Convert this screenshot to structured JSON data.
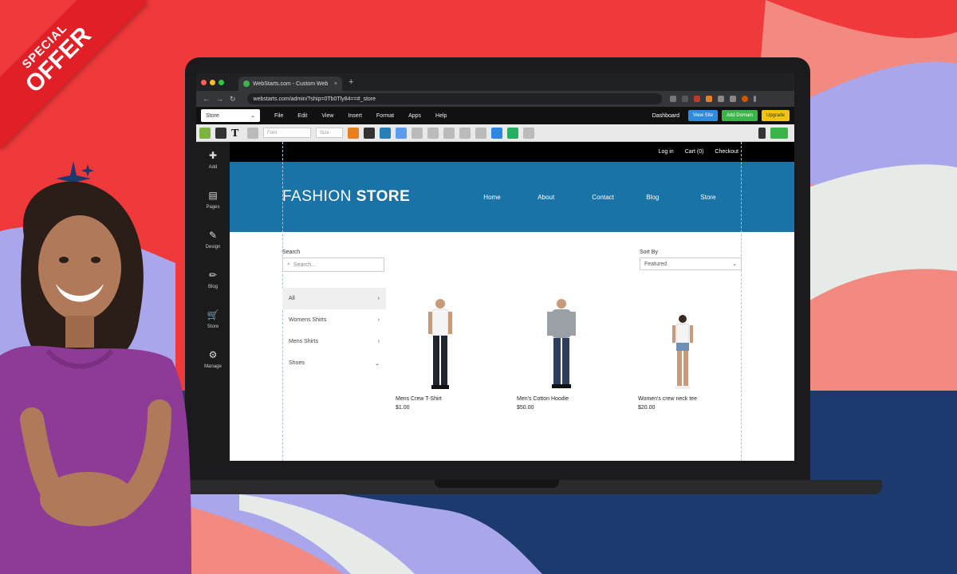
{
  "promo": {
    "line1": "SPECIAL",
    "line2": "OFFER"
  },
  "browser": {
    "tab_title": "WebStarts.com - Custom Web",
    "tab_close": "×",
    "new_tab": "+",
    "url": "webstarts.com/admin/?ship=0Tb0Tly84==#_store"
  },
  "editor": {
    "page_select": "Store",
    "menu": [
      "File",
      "Edit",
      "View",
      "Insert",
      "Format",
      "Apps",
      "Help"
    ],
    "dashboard": "Dashboard",
    "view_site": "View Site",
    "add_domain": "Add Domain",
    "upgrade": "Upgrade",
    "font_select": "Font",
    "size_select": "Size",
    "sidebar": [
      {
        "label": "Add",
        "icon": "plus-icon"
      },
      {
        "label": "Pages",
        "icon": "page-icon"
      },
      {
        "label": "Design",
        "icon": "brush-icon"
      },
      {
        "label": "Blog",
        "icon": "pencil-icon"
      },
      {
        "label": "Store",
        "icon": "cart-icon"
      },
      {
        "label": "Manage",
        "icon": "gear-icon"
      }
    ]
  },
  "site": {
    "top_links": [
      "Log in",
      "Cart (0)",
      "Checkout"
    ],
    "logo_light": "FASHION ",
    "logo_bold": "STORE",
    "nav": [
      "Home",
      "About",
      "Contact",
      "Blog",
      "Store"
    ],
    "search_label": "Search",
    "search_placeholder": "Search...",
    "sort_label": "Sort By",
    "sort_value": "Featured",
    "categories": [
      {
        "label": "All",
        "active": true
      },
      {
        "label": "Womens Shirts",
        "active": false
      },
      {
        "label": "Mens Shirts",
        "active": false
      },
      {
        "label": "Shoes",
        "active": false
      }
    ],
    "products": [
      {
        "name": "Mens Crew T-Shirt",
        "price": "$1.00",
        "top": "#ffffff",
        "bottom": "#1f2430"
      },
      {
        "name": "Men's Cotton Hoodie",
        "price": "$50.00",
        "top": "#9aa0a6",
        "bottom": "#2c3e5c"
      },
      {
        "name": "Women's crew neck tee",
        "price": "$20.00",
        "top": "#ffffff",
        "bottom": "#6d8fb5"
      }
    ]
  },
  "colors": {
    "accent_red": "#f0393b",
    "hero_blue": "#1a73a7",
    "navy": "#1d3a6e",
    "lavender": "#a9a6ec",
    "salmon": "#f38a82"
  }
}
